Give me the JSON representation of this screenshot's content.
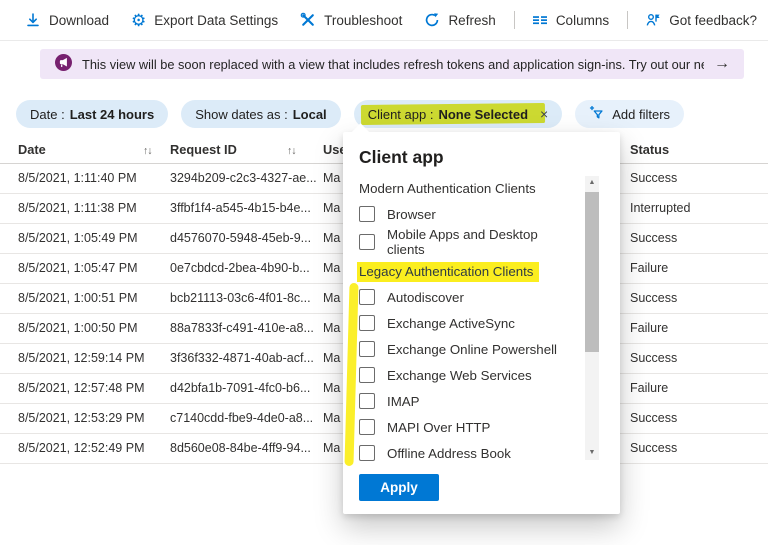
{
  "toolbar": {
    "download": "Download",
    "export": "Export Data Settings",
    "troubleshoot": "Troubleshoot",
    "refresh": "Refresh",
    "columns": "Columns",
    "feedback": "Got feedback?",
    "gear_glyph": "⚙"
  },
  "banner": {
    "message": "This view will be soon replaced with a view that includes refresh tokens and application sign-ins. Try out our new sign-ins preview.",
    "arrow": "→"
  },
  "filters": {
    "date": {
      "label": "Date :",
      "value": "Last 24 hours"
    },
    "show_dates": {
      "label": "Show dates as :",
      "value": "Local"
    },
    "client_app": {
      "label": "Client app :",
      "value": "None Selected",
      "close": "×"
    },
    "add": "Add filters"
  },
  "table": {
    "headers": {
      "date": "Date",
      "request_id": "Request ID",
      "user": "Use",
      "status": "Status"
    },
    "sort_glyph": "↑↓",
    "rows": [
      {
        "date": "8/5/2021, 1:11:40 PM",
        "request_id": "3294b209-c2c3-4327-ae...",
        "user": "Ma",
        "status": "Success"
      },
      {
        "date": "8/5/2021, 1:11:38 PM",
        "request_id": "3ffbf1f4-a545-4b15-b4e...",
        "user": "Ma",
        "status": "Interrupted"
      },
      {
        "date": "8/5/2021, 1:05:49 PM",
        "request_id": "d4576070-5948-45eb-9...",
        "user": "Ma",
        "status": "Success"
      },
      {
        "date": "8/5/2021, 1:05:47 PM",
        "request_id": "0e7cbdcd-2bea-4b90-b...",
        "user": "Ma",
        "status": "Failure"
      },
      {
        "date": "8/5/2021, 1:00:51 PM",
        "request_id": "bcb21113-03c6-4f01-8c...",
        "user": "Ma",
        "status": "Success"
      },
      {
        "date": "8/5/2021, 1:00:50 PM",
        "request_id": "88a7833f-c491-410e-a8...",
        "user": "Ma",
        "status": "Failure"
      },
      {
        "date": "8/5/2021, 12:59:14 PM",
        "request_id": "3f36f332-4871-40ab-acf...",
        "user": "Ma",
        "status": "Success"
      },
      {
        "date": "8/5/2021, 12:57:48 PM",
        "request_id": "d42bfa1b-7091-4fc0-b6...",
        "user": "Ma",
        "status": "Failure"
      },
      {
        "date": "8/5/2021, 12:53:29 PM",
        "request_id": "c7140cdd-fbe9-4de0-a8...",
        "user": "Ma",
        "status": "Success"
      },
      {
        "date": "8/5/2021, 12:52:49 PM",
        "request_id": "8d560e08-84be-4ff9-94...",
        "user": "Ma",
        "status": "Success"
      }
    ]
  },
  "popup": {
    "title": "Client app",
    "modern": {
      "label": "Modern Authentication Clients",
      "items": [
        "Browser",
        "Mobile Apps and Desktop clients"
      ]
    },
    "legacy": {
      "label": "Legacy Authentication Clients",
      "items": [
        "Autodiscover",
        "Exchange ActiveSync",
        "Exchange Online Powershell",
        "Exchange Web Services",
        "IMAP",
        "MAPI Over HTTP",
        "Offline Address Book"
      ]
    },
    "apply": "Apply",
    "scroll_up": "▲",
    "scroll_down": "▼"
  },
  "colors": {
    "accent": "#0078d4",
    "highlight_yellow": "#fbee1f",
    "pill_highlight": "#c9d60e",
    "pill_bg": "#dcebf8",
    "banner_bg": "#f0e6f7",
    "banner_icon_purple": "#77216f"
  }
}
